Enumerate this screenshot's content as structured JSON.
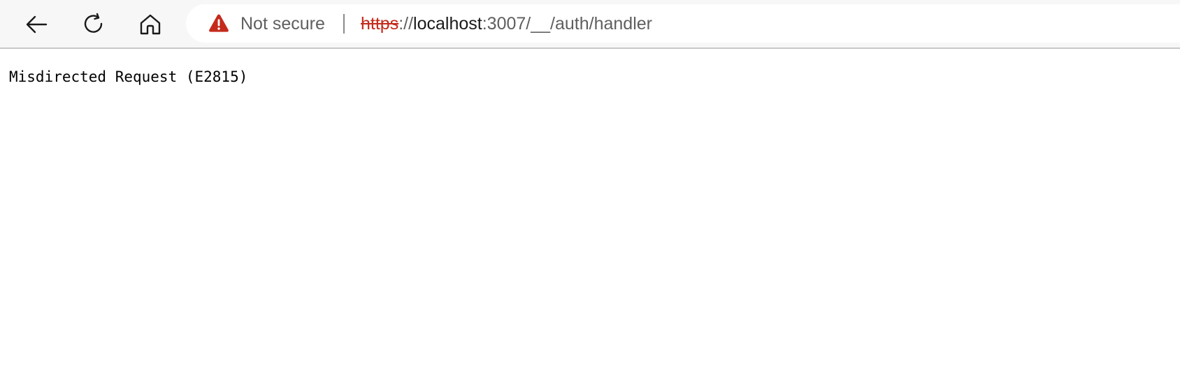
{
  "toolbar": {
    "back_icon": "arrow-left-icon",
    "reload_icon": "reload-icon",
    "home_icon": "home-icon"
  },
  "address_bar": {
    "security_icon": "warning-triangle-icon",
    "security_label": "Not secure",
    "url_scheme": "https",
    "url_separator": "://",
    "url_host": "localhost",
    "url_rest": ":3007/__/auth/handler",
    "warning_color": "#c42b1c"
  },
  "page": {
    "message": "Misdirected Request (E2815)"
  }
}
